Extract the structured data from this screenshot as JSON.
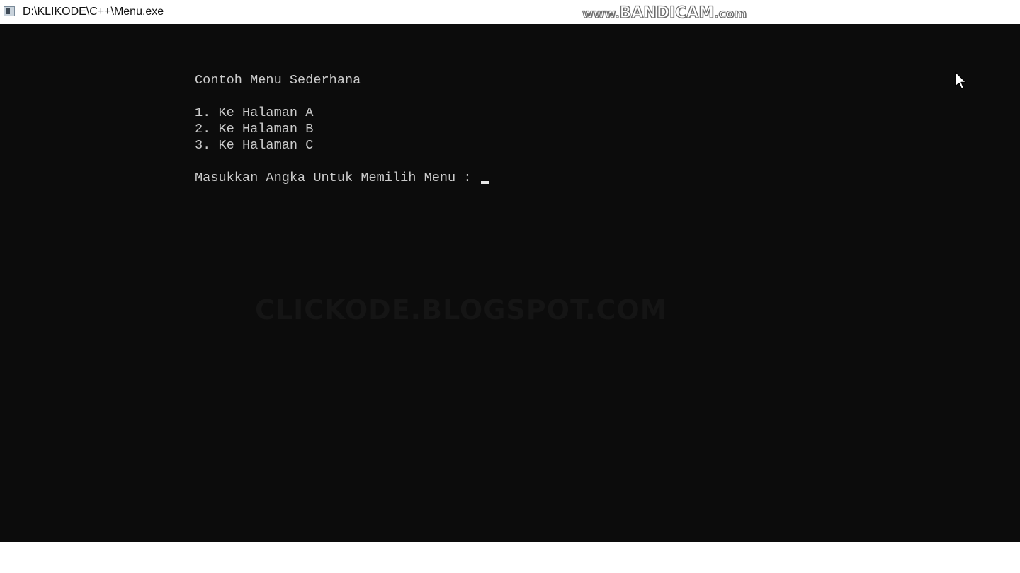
{
  "window": {
    "title": "D:\\KLIKODE\\C++\\Menu.exe"
  },
  "recorder_watermark": {
    "prefix": "www.",
    "brand": "BANDICAM",
    "suffix": ".com"
  },
  "console": {
    "heading": "Contoh Menu Sederhana",
    "menu_items": [
      "1. Ke Halaman A",
      "2. Ke Halaman B",
      "3. Ke Halaman C"
    ],
    "prompt": "Masukkan Angka Untuk Memilih Menu : ",
    "background_watermark": "CLICKODE.BLOGSPOT.COM"
  },
  "colors": {
    "console_background": "#0c0c0c",
    "console_text": "#cccccc",
    "titlebar_background": "#ffffff"
  },
  "icons": {
    "app_icon": "console-window-icon",
    "mouse_pointer": "arrow-pointer-icon"
  }
}
